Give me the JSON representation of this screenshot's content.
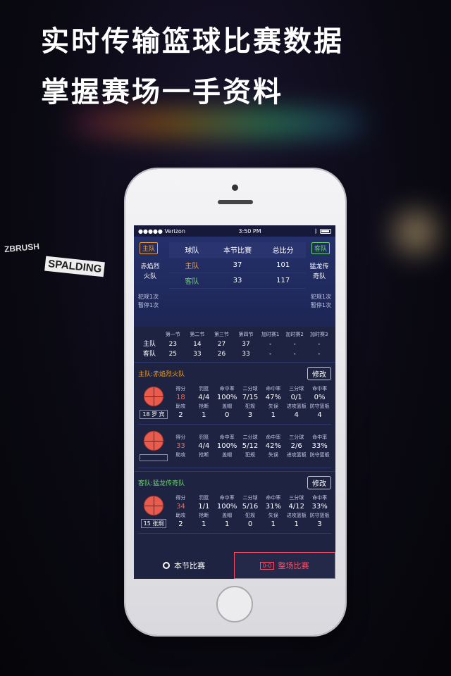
{
  "promo": {
    "line1": "实时传输篮球比赛数据",
    "line2": "掌握赛场一手资料",
    "sponsor1": "ZBRUSH",
    "sponsor2": "SPALDING"
  },
  "statusbar": {
    "carrier": "●●●●● Verizon",
    "time": "3:50 PM",
    "bluetooth": "ᛒ"
  },
  "scoreboard": {
    "home_tag": "主队",
    "away_tag": "客队",
    "home_team": "赤焰烈火队",
    "away_team": "猛龙传奇队",
    "headers": [
      "球队",
      "本节比赛",
      "总比分"
    ],
    "rows": [
      {
        "team": "主队",
        "period": "37",
        "total": "101"
      },
      {
        "team": "客队",
        "period": "33",
        "total": "117"
      }
    ],
    "home_fouls": "犯规1次",
    "home_timeouts": "暂停1次",
    "away_fouls": "犯规1次",
    "away_timeouts": "暂停1次"
  },
  "quarters": {
    "headers": [
      "",
      "第一节",
      "第二节",
      "第三节",
      "第四节",
      "加时赛1",
      "加时赛2",
      "加时赛3"
    ],
    "rows": [
      [
        "主队",
        "23",
        "14",
        "27",
        "37",
        "-",
        "-",
        "-"
      ],
      [
        "客队",
        "25",
        "33",
        "26",
        "33",
        "-",
        "-",
        "-"
      ]
    ]
  },
  "home_section": {
    "label": "主队:",
    "team": "赤焰烈火队",
    "edit": "修改",
    "players": [
      {
        "name": "18 罗 宾",
        "top_labels": [
          "得分",
          "罚篮",
          "命中率",
          "二分球",
          "命中率",
          "三分球",
          "命中率"
        ],
        "top_values": [
          "18",
          "4/4",
          "100%",
          "7/15",
          "47%",
          "0/1",
          "0%"
        ],
        "bot_labels": [
          "助攻",
          "抢断",
          "盖帽",
          "犯规",
          "失误",
          "进攻篮板",
          "防守篮板"
        ],
        "bot_values": [
          "2",
          "1",
          "0",
          "3",
          "1",
          "4",
          "4"
        ]
      },
      {
        "name": "",
        "top_labels": [
          "得分",
          "罚篮",
          "命中率",
          "二分球",
          "命中率",
          "三分球",
          "命中率"
        ],
        "top_values": [
          "33",
          "4/4",
          "100%",
          "5/12",
          "42%",
          "2/6",
          "33%"
        ],
        "bot_labels": [
          "助攻",
          "抢断",
          "盖帽",
          "犯规",
          "失误",
          "进攻篮板",
          "防守篮板"
        ],
        "bot_values": []
      }
    ]
  },
  "away_section": {
    "label": "客队:",
    "team": "猛龙传奇队",
    "edit": "修改",
    "players": [
      {
        "name": "15 张炯",
        "top_labels": [
          "得分",
          "罚篮",
          "命中率",
          "二分球",
          "命中率",
          "三分球",
          "命中率"
        ],
        "top_values": [
          "34",
          "1/1",
          "100%",
          "5/16",
          "31%",
          "4/12",
          "33%"
        ],
        "bot_labels": [
          "助攻",
          "抢断",
          "盖帽",
          "犯规",
          "失误",
          "进攻篮板",
          "防守篮板"
        ],
        "bot_values": [
          "2",
          "1",
          "1",
          "0",
          "1",
          "1",
          "3"
        ]
      }
    ]
  },
  "tabs": {
    "period": "本节比赛",
    "full": "整场比赛",
    "full_icon_text": "0-0"
  },
  "colors": {
    "home": "#f0a030",
    "away": "#6fd36f",
    "accent": "#ff4c64"
  }
}
